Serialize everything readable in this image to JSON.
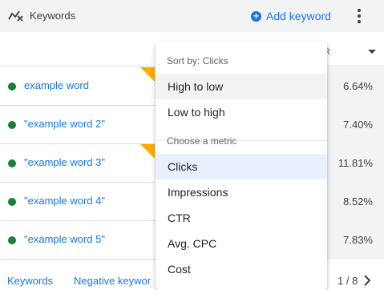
{
  "header": {
    "title": "Keywords",
    "add_keyword": "Add keyword",
    "add_icon": "plus-circle-icon",
    "more_icon": "more-vert-icon"
  },
  "table": {
    "column_partial_header": "R",
    "rows": [
      {
        "keyword": "example word",
        "value": "6.64%",
        "status": "eligible",
        "flagged": true
      },
      {
        "keyword": "\"example word 2\"",
        "value": "7.40%",
        "status": "eligible",
        "flagged": false
      },
      {
        "keyword": "\"example word 3\"",
        "value": "11.81%",
        "status": "eligible",
        "flagged": true
      },
      {
        "keyword": "\"example word 4\"",
        "value": "8.52%",
        "status": "eligible",
        "flagged": false
      },
      {
        "keyword": "\"example word 5\"",
        "value": "7.83%",
        "status": "eligible",
        "flagged": false
      }
    ]
  },
  "footer": {
    "tab_keywords": "Keywords",
    "tab_negative": "Negative keywor",
    "pager": "1 / 8"
  },
  "menu": {
    "sort_label": "Sort by: Clicks",
    "sort_options": [
      "High to low",
      "Low to high"
    ],
    "metric_label": "Choose a metric",
    "metrics": [
      "Clicks",
      "Impressions",
      "CTR",
      "Avg. CPC",
      "Cost"
    ],
    "selected_metric": "Clicks",
    "hovered_option": "High to low"
  },
  "colors": {
    "accent": "#1a73e8",
    "status_green": "#188038",
    "flag": "#f9ab00",
    "selected_bg": "#e8f0fe"
  }
}
